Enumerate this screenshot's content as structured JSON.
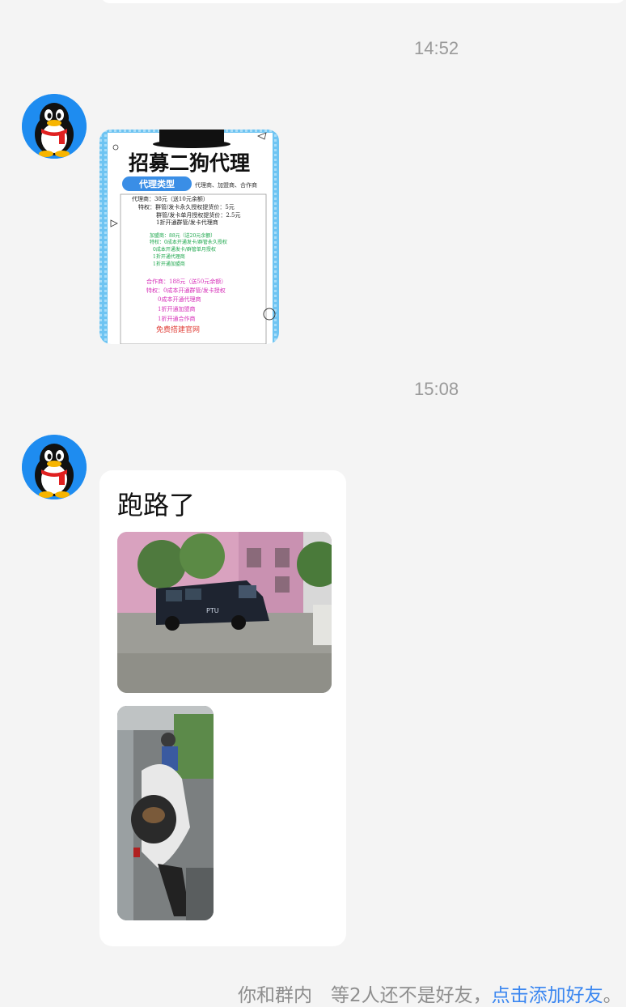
{
  "timeline": {
    "timestamp_1": "14:52",
    "timestamp_2": "15:08"
  },
  "messages": [
    {
      "sender_avatar": "qq-penguin-avatar",
      "type": "image",
      "poster": {
        "title": "招募二狗代理",
        "badge": "代理类型",
        "tag_line": "代理商、加盟商、合作商",
        "agent_lines": [
          "代理商：38元（送10元余额）",
          "特权：群管/发卡永久授权提货价：5元",
          "群管/发卡单月授权提货价：2.5元",
          "1折开通群管/发卡代理商"
        ],
        "franchise_lines": [
          "加盟商：88元（送20元余额）",
          "特权：0成本开通发卡/群管永久授权",
          "0成本开通发卡/群管单月授权",
          "1折开通代理商",
          "1折开通加盟商"
        ],
        "partner_lines": [
          "合作商：188元（送50元余额）",
          "特权：0成本开通群管/发卡授权",
          "0成本开通代理商",
          "1折开通加盟商",
          "1折开通合作商"
        ],
        "footer": "免费搭建官网"
      }
    },
    {
      "sender_avatar": "qq-penguin-avatar",
      "type": "text-with-images",
      "text": "跑路了",
      "photos": [
        "police-van-photo",
        "motorbike-photo"
      ],
      "van_text": "PTU"
    }
  ],
  "notice": {
    "prefix": "你和群内　等2人还不是好友，",
    "link": "点击添加好友",
    "suffix": "。"
  },
  "colors": {
    "background": "#f4f4f4",
    "bubble": "#ffffff",
    "link": "#3a86f0",
    "avatar_bg": "#1e8cf0"
  }
}
